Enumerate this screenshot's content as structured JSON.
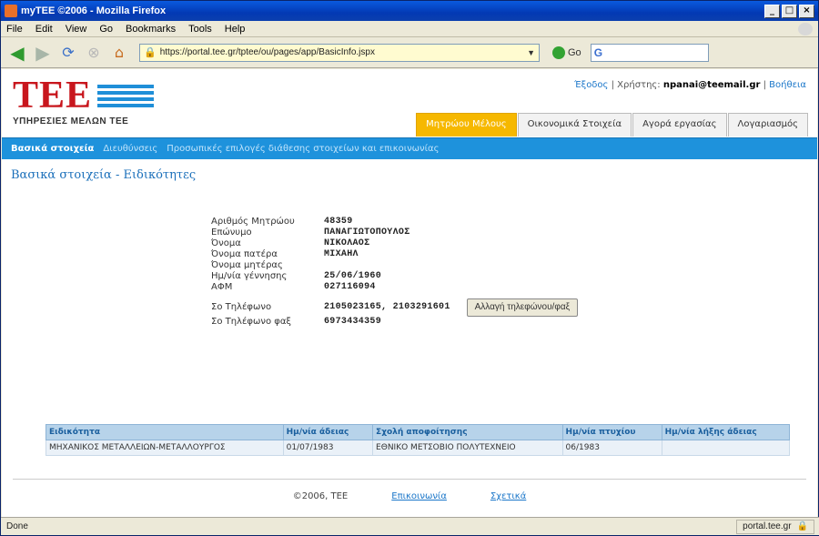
{
  "window": {
    "title": "myTEE ©2006 - Mozilla Firefox",
    "controls": [
      "_",
      "□",
      "×"
    ]
  },
  "menu": [
    "File",
    "Edit",
    "View",
    "Go",
    "Bookmarks",
    "Tools",
    "Help"
  ],
  "navbar": {
    "url": "https://portal.tee.gr/tptee/ou/pages/app/BasicInfo.jspx",
    "go_label": "Go",
    "search_placeholder": "G"
  },
  "header": {
    "logo_text": "TEE",
    "logo_subtitle": "ΥΠΗΡΕΣΙΕΣ ΜΕΛΩΝ ΤΕΕ",
    "exit_label": "Έξοδος",
    "user_prefix": "Χρήστης:",
    "user_email": "npanai@teemail.gr",
    "help_label": "Βοήθεια"
  },
  "tabs": [
    "Μητρώου Μέλους",
    "Οικονομικά Στοιχεία",
    "Αγορά εργασίας",
    "Λογαριασμός"
  ],
  "subnav": [
    "Βασικά στοιχεία",
    "Διευθύνσεις",
    "Προσωπικές επιλογές διάθεσης στοιχείων και επικοινωνίας"
  ],
  "section_title": "Βασικά στοιχεία - Ειδικότητες",
  "details": {
    "group1": [
      {
        "label": "Αριθμός Μητρώου",
        "value": "48359"
      },
      {
        "label": "Επώνυμο",
        "value": "ΠΑΝΑΓΙΩΤΟΠΟΥΛΟΣ"
      },
      {
        "label": "Όνομα",
        "value": "ΝΙΚΟΛΑΟΣ"
      },
      {
        "label": "Όνομα πατέρα",
        "value": "ΜΙΧΑΗΛ"
      },
      {
        "label": "Όνομα μητέρας",
        "value": ""
      },
      {
        "label": "Ημ/νία γέννησης",
        "value": "25/06/1960"
      },
      {
        "label": "ΑΦΜ",
        "value": "027116094"
      }
    ],
    "phone_label": "Σο Τηλέφωνο",
    "phone_value": "2105023165, 2103291601",
    "fax_label": "Σο Τηλέφωνο φαξ",
    "fax_value": "6973434359",
    "change_button": "Αλλαγή τηλεφώνου/φαξ"
  },
  "table": {
    "headers": [
      "Ειδικότητα",
      "Ημ/νία άδειας",
      "Σχολή αποφοίτησης",
      "Ημ/νία πτυχίου",
      "Ημ/νία λήξης άδειας"
    ],
    "rows": [
      [
        "ΜΗΧΑΝΙΚΟΣ ΜΕΤΑΛΛΕΙΩΝ-ΜΕΤΑΛΛΟΥΡΓΟΣ",
        "01/07/1983",
        "ΕΘΝΙΚΟ ΜΕΤΣΟΒΙΟ ΠΟΛΥΤΕΧΝΕΙΟ",
        "06/1983",
        ""
      ]
    ]
  },
  "footer": {
    "copyright": "©2006, ΤΕΕ",
    "contact": "Επικοινωνία",
    "terms": "Σχετικά"
  },
  "status": {
    "left": "Done",
    "host": "portal.tee.gr"
  },
  "colors": {
    "accent_blue": "#1e92dc",
    "tab_active": "#f6b800",
    "logo_red": "#c8161d"
  }
}
